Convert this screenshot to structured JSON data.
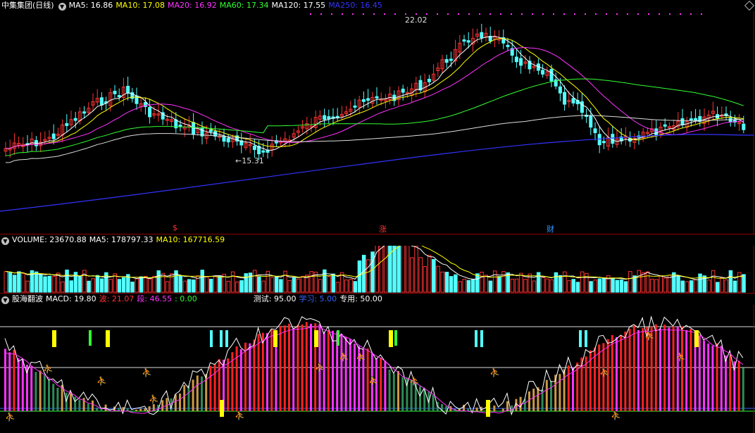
{
  "main": {
    "title": "中集集团(日线)",
    "ma": [
      {
        "label": "MA5: 16.86",
        "color": "#ffffff"
      },
      {
        "label": "MA10: 17.08",
        "color": "#ffff00"
      },
      {
        "label": "MA20: 16.92",
        "color": "#ff33ff"
      },
      {
        "label": "MA60: 17.34",
        "color": "#33ff33"
      },
      {
        "label": "MA120: 17.55",
        "color": "#ffffff"
      },
      {
        "label": "MA250: 16.45",
        "color": "#3333ff"
      }
    ],
    "high_label": "22.02",
    "low_label": "15.31",
    "events": [
      {
        "label": "$",
        "color": "#ff3333"
      },
      {
        "label": "涨",
        "color": "#ff3333"
      },
      {
        "label": "财",
        "color": "#3399ff"
      }
    ]
  },
  "volume": {
    "title": "VOLUME: 23670.88",
    "ma5": "MA5: 178797.33",
    "ma10": "MA10: 167716.59"
  },
  "indicator": {
    "title": "股海翻波",
    "macd": "MACD: 19.80",
    "bo": "波: 21.07",
    "duan": "段: 46.55",
    "zero": ": 0.00",
    "test": "测试: 95.00",
    "study": "学习: 5.00",
    "special": "专用: 50.00"
  },
  "colors": {
    "up": "#ff3333",
    "down": "#54ffff",
    "grid": "#8b0000",
    "ma5": "#ffffff",
    "ma10": "#ffff00",
    "ma20": "#ff33ff",
    "ma60": "#33ff33",
    "ma120": "#dddddd",
    "ma250": "#3333ff"
  }
}
